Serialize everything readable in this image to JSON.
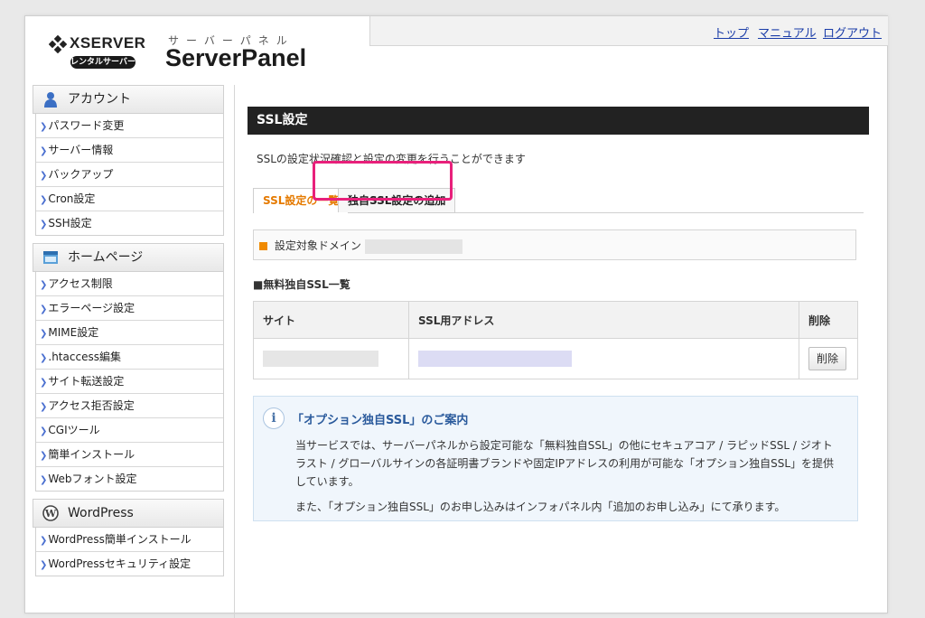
{
  "header": {
    "logo_brand": "XSERVER",
    "logo_rental": "レンタルサーバー",
    "logo_sub": "サーバーパネル",
    "logo_title": "ServerPanel",
    "nav": [
      "トップ",
      "マニュアル",
      "ログアウト"
    ]
  },
  "sidebar": {
    "sections": [
      {
        "title": "アカウント",
        "icon": "user-icon",
        "items": [
          "パスワード変更",
          "サーバー情報",
          "バックアップ",
          "Cron設定",
          "SSH設定"
        ]
      },
      {
        "title": "ホームページ",
        "icon": "homepage-icon",
        "items": [
          "アクセス制限",
          "エラーページ設定",
          "MIME設定",
          ".htaccess編集",
          "サイト転送設定",
          "アクセス拒否設定",
          "CGIツール",
          "簡単インストール",
          "Webフォント設定"
        ]
      },
      {
        "title": "WordPress",
        "icon": "wordpress-icon",
        "items": [
          "WordPress簡単インストール",
          "WordPressセキュリティ設定"
        ]
      }
    ]
  },
  "main": {
    "title": "SSL設定",
    "description": "SSLの設定状況確認と設定の変更を行うことができます",
    "tabs": [
      "SSL設定の一覧",
      "独自SSL設定の追加"
    ],
    "domain_label": "設定対象ドメイン",
    "list_title": "■無料独自SSL一覧",
    "table": {
      "headers": [
        "サイト",
        "SSL用アドレス",
        "削除"
      ],
      "delete_button": "削除"
    },
    "info": {
      "title": "「オプション独自SSL」のご案内",
      "paragraph1": "当サービスでは、サーバーパネルから設定可能な「無料独自SSL」の他にセキュアコア / ラピッドSSL / ジオトラスト / グローバルサインの各証明書ブランドや固定IPアドレスの利用が可能な「オプション独自SSL」を提供しています。",
      "paragraph2": "また、「オプション独自SSL」のお申し込みはインフォパネル内「追加のお申し込み」にて承ります。"
    }
  },
  "colors": {
    "accent_tab": "#e57a00",
    "highlight": "#e8207b",
    "link": "#1a3ca8"
  }
}
